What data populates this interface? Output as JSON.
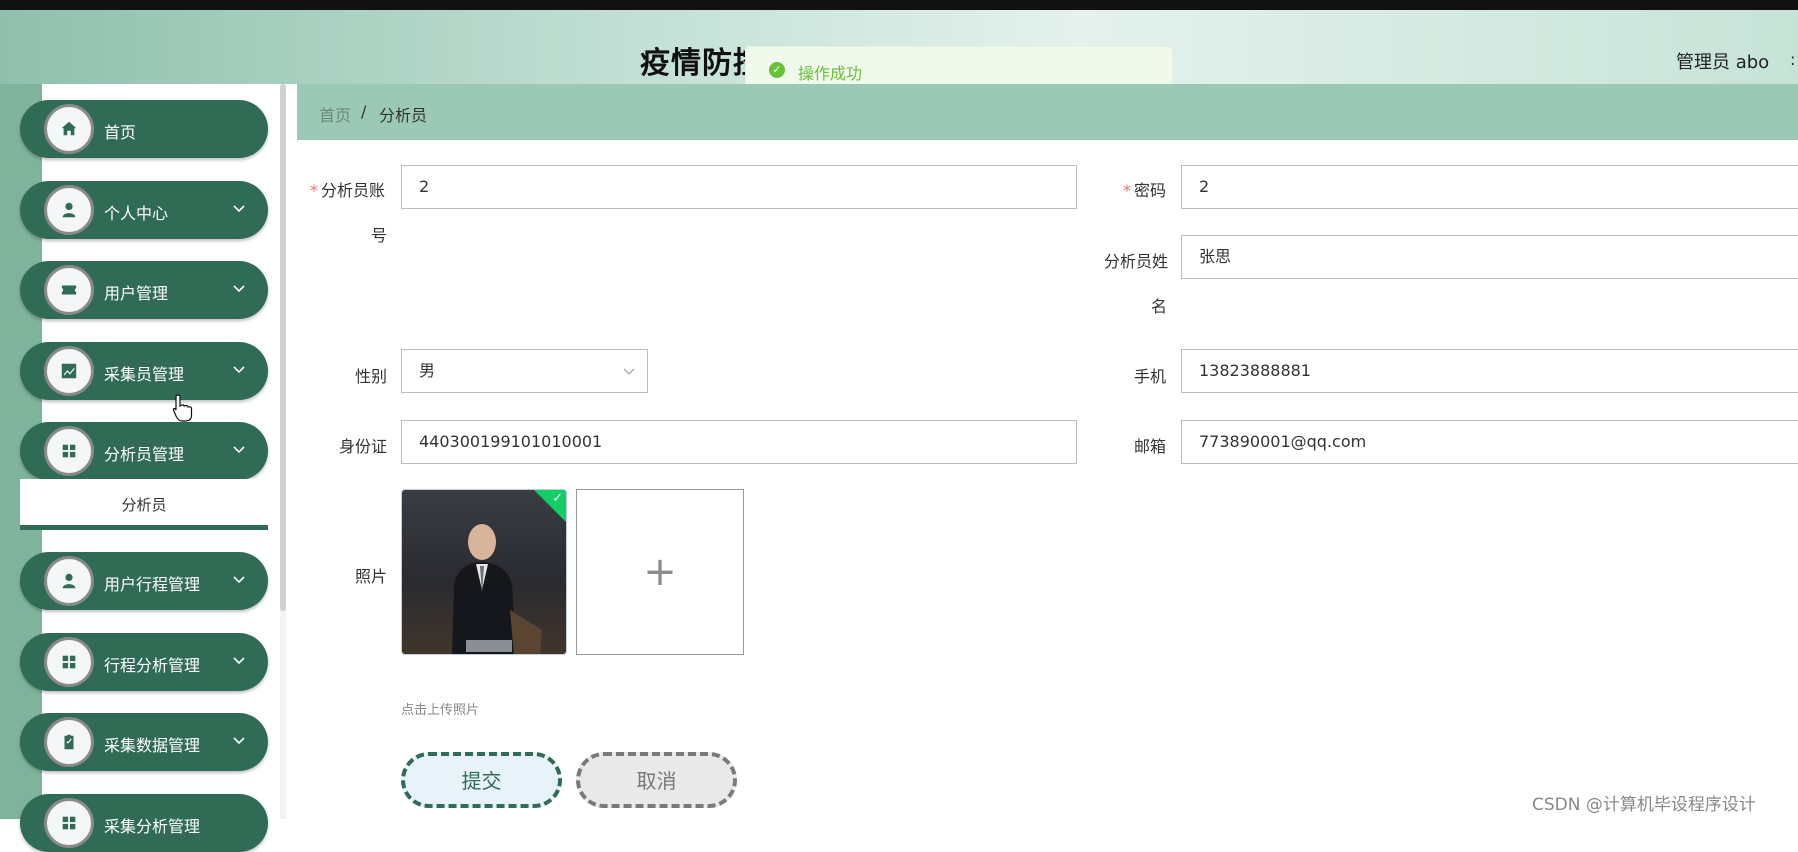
{
  "header": {
    "title": "疫情防控溯源大数据管理系统",
    "user": "管理员 abo"
  },
  "toast": {
    "text": "操作成功"
  },
  "sidebar": {
    "items": [
      {
        "label": "首页",
        "icon": "home-icon",
        "expandable": false
      },
      {
        "label": "个人中心",
        "icon": "user-icon",
        "expandable": true
      },
      {
        "label": "用户管理",
        "icon": "ticket-icon",
        "expandable": true
      },
      {
        "label": "采集员管理",
        "icon": "chart-icon",
        "expandable": true
      },
      {
        "label": "分析员管理",
        "icon": "grid-icon",
        "expandable": true,
        "expanded": true
      },
      {
        "label": "用户行程管理",
        "icon": "user-icon",
        "expandable": true
      },
      {
        "label": "行程分析管理",
        "icon": "grid-icon",
        "expandable": true
      },
      {
        "label": "采集数据管理",
        "icon": "clipboard-icon",
        "expandable": true
      },
      {
        "label": "采集分析管理",
        "icon": "grid-icon",
        "expandable": true
      }
    ],
    "subitem": "分析员"
  },
  "breadcrumb": {
    "home": "首页",
    "separator": "/",
    "current": "分析员"
  },
  "form": {
    "account": {
      "label_line1": "分析员账",
      "label_line2": "号",
      "value": "2",
      "required": true
    },
    "password": {
      "label": "密码",
      "value": "2",
      "required": true
    },
    "name": {
      "label_line1": "分析员姓",
      "label_line2": "名",
      "value": "张思"
    },
    "gender": {
      "label": "性别",
      "value": "男"
    },
    "phone": {
      "label": "手机",
      "value": "13823888881"
    },
    "idcard": {
      "label": "身份证",
      "value": "440300199101010001"
    },
    "email": {
      "label": "邮箱",
      "value": "773890001@qq.com"
    },
    "photo": {
      "label": "照片",
      "hint": "点击上传照片",
      "add_symbol": "+"
    },
    "submit": "提交",
    "cancel": "取消"
  },
  "watermark": "CSDN @计算机毕设程序设计",
  "colors": {
    "primary": "#2f6b55",
    "breadcrumb_bg": "#9cc8b6",
    "required": "#f56c6c",
    "success": "#67c23a"
  }
}
